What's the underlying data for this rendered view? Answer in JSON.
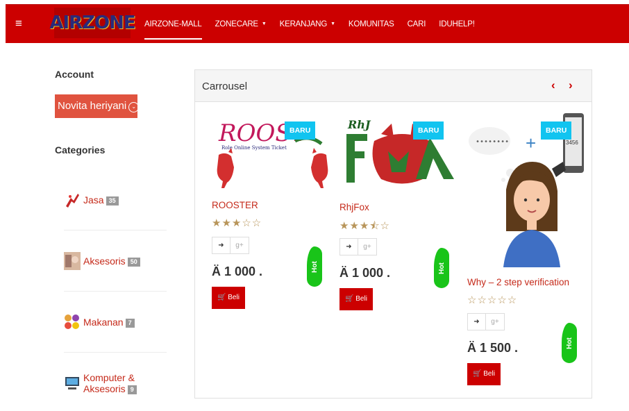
{
  "navbar": {
    "menu_icon": "hamburger-icon",
    "logo_text": "AIRZONE",
    "links": [
      {
        "label": "AIRZONE-MALL",
        "dropdown": false
      },
      {
        "label": "ZONECARE",
        "dropdown": true
      },
      {
        "label": "KERANJANG",
        "dropdown": true
      },
      {
        "label": "KOMUNITAS",
        "dropdown": false
      },
      {
        "label": "CARI",
        "dropdown": false
      },
      {
        "label": "IDUHELP!",
        "dropdown": false
      }
    ],
    "color": "#cc0000"
  },
  "sidebar": {
    "account_title": "Account",
    "user_name": "Novita heriyani",
    "categories_title": "Categories",
    "categories": [
      {
        "label": "Jasa",
        "count": "35"
      },
      {
        "label": "Aksesoris",
        "count": "50"
      },
      {
        "label": "Makanan",
        "count": "7"
      },
      {
        "label": "Komputer & Aksesoris",
        "count": "9"
      }
    ]
  },
  "carousel": {
    "title": "Carrousel",
    "prev_icon": "chevron-left-icon",
    "next_icon": "chevron-right-icon",
    "products": [
      {
        "name": "ROOSTER",
        "badge": "BARU",
        "rating": 3,
        "rating_text": "★★★☆☆",
        "price": "Ä 1 000 .",
        "buy_label": "Beli",
        "hot_label": "Hot"
      },
      {
        "name": "RhjFox",
        "badge": "BARU",
        "rating": 3.5,
        "rating_text": "★★★⯪☆",
        "price": "Ä 1 000 .",
        "buy_label": "Beli",
        "hot_label": "Hot"
      },
      {
        "name": "Why – 2 step verification",
        "badge": "BARU",
        "rating": 0,
        "rating_text": "☆☆☆☆☆",
        "price": "Ä 1 500 .",
        "buy_label": "Beli",
        "hot_label": "Hot"
      }
    ]
  },
  "colors": {
    "accent": "#cc0000",
    "badge_new": "#11c4f0",
    "hot": "#19c419",
    "star": "#b8955a",
    "user_button": "#e0533f"
  }
}
